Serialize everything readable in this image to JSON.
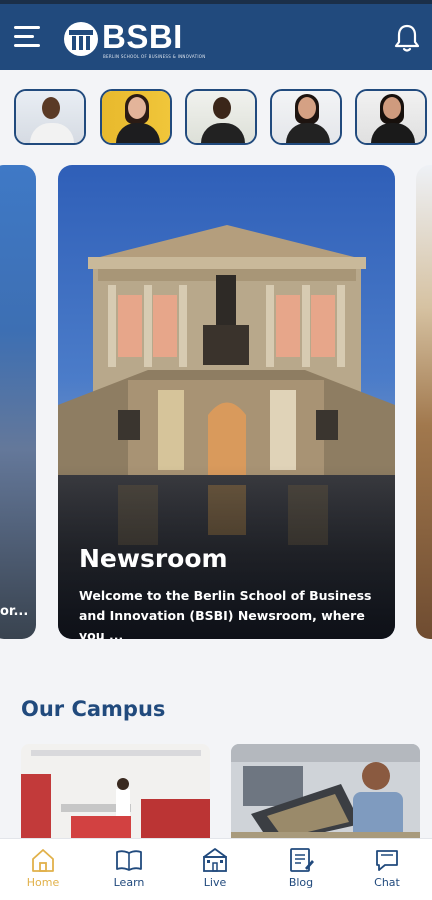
{
  "app": {
    "logo_text": "BSBI",
    "logo_subtitle": "BERLIN SCHOOL OF BUSINESS & INNOVATION"
  },
  "colors": {
    "primary": "#214a7d",
    "accent": "#e1b14a",
    "background": "#f3f4f7"
  },
  "icons": {
    "menu": "hamburger-menu-icon",
    "notifications": "bell-icon"
  },
  "stories": [
    {
      "name": "story-1"
    },
    {
      "name": "story-2"
    },
    {
      "name": "story-3"
    },
    {
      "name": "story-4"
    },
    {
      "name": "story-5"
    }
  ],
  "carousel": {
    "left_card_text": "or...",
    "main_card": {
      "title": "Newsroom",
      "description": "Welcome to the Berlin School of Business and Innovation (BSBI) Newsroom, where you ..."
    }
  },
  "campus": {
    "title": "Our Campus"
  },
  "nav": {
    "items": [
      {
        "label": "Home",
        "icon": "home-icon"
      },
      {
        "label": "Learn",
        "icon": "book-icon"
      },
      {
        "label": "Live",
        "icon": "building-icon"
      },
      {
        "label": "Blog",
        "icon": "blog-icon"
      },
      {
        "label": "Chat",
        "icon": "chat-icon"
      }
    ],
    "active": "Home"
  }
}
